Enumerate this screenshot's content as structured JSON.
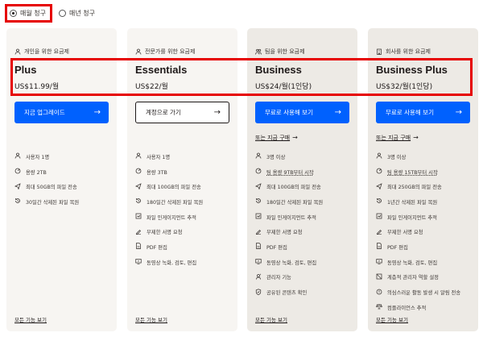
{
  "billing": {
    "monthly_label": "매월 청구",
    "yearly_label": "매년 청구",
    "selected": "monthly"
  },
  "plans": [
    {
      "audience": "개인을 위한 요금제",
      "audience_icon": "person-icon",
      "name": "Plus",
      "price": "US$11.99/월",
      "cta": "지금 업그레이드",
      "cta_style": "blue",
      "buy_link": "",
      "features": [
        {
          "icon": "person-icon",
          "text": "사용자 1명"
        },
        {
          "icon": "storage-icon",
          "text": "용량 2TB"
        },
        {
          "icon": "transfer-icon",
          "text": "최대 50GB의 파일 전송"
        },
        {
          "icon": "restore-icon",
          "text": "30일간 삭제된 파일 복원"
        }
      ],
      "more": "모든 기능 보기"
    },
    {
      "audience": "전문가를 위한 요금제",
      "audience_icon": "person-icon",
      "name": "Essentials",
      "price": "US$22/월",
      "cta": "계정으로 가기",
      "cta_style": "outline",
      "buy_link": "",
      "features": [
        {
          "icon": "person-icon",
          "text": "사용자 1명"
        },
        {
          "icon": "storage-icon",
          "text": "용량 3TB"
        },
        {
          "icon": "transfer-icon",
          "text": "최대 100GB의 파일 전송"
        },
        {
          "icon": "restore-icon",
          "text": "180일간 삭제된 파일 복원"
        },
        {
          "icon": "engagement-icon",
          "text": "파일 인게이지먼트 추적"
        },
        {
          "icon": "signature-icon",
          "text": "무제한 서명 요청"
        },
        {
          "icon": "pdf-icon",
          "text": "PDF 편집"
        },
        {
          "icon": "review-icon",
          "text": "동영상 녹화, 검토, 편집"
        }
      ],
      "more": "모든 기능 보기"
    },
    {
      "audience": "팀을 위한 요금제",
      "audience_icon": "team-icon",
      "name": "Business",
      "price": "US$24/월(1인당)",
      "cta": "무료로 사용해 보기",
      "cta_style": "blue",
      "buy_link": "또는 지금 구매",
      "features": [
        {
          "icon": "person-icon",
          "text": "3명 이상"
        },
        {
          "icon": "storage-icon",
          "text": "팀 용량 9TB부터 시작",
          "underline": true
        },
        {
          "icon": "transfer-icon",
          "text": "최대 100GB의 파일 전송"
        },
        {
          "icon": "restore-icon",
          "text": "180일간 삭제된 파일 복원"
        },
        {
          "icon": "engagement-icon",
          "text": "파일 인게이지먼트 추적"
        },
        {
          "icon": "signature-icon",
          "text": "무제한 서명 요청"
        },
        {
          "icon": "pdf-icon",
          "text": "PDF 편집"
        },
        {
          "icon": "review-icon",
          "text": "동영상 녹화, 검토, 편집"
        },
        {
          "icon": "admin-icon",
          "text": "관리자 기능"
        },
        {
          "icon": "shield-icon",
          "text": "공유된 콘텐츠 확인"
        }
      ],
      "more": "모든 기능 보기"
    },
    {
      "audience": "회사를 위한 요금제",
      "audience_icon": "building-icon",
      "name": "Business Plus",
      "price": "US$32/월(1인당)",
      "cta": "무료로 사용해 보기",
      "cta_style": "blue",
      "buy_link": "또는 지금 구매",
      "features": [
        {
          "icon": "person-icon",
          "text": "3명 이상"
        },
        {
          "icon": "storage-icon",
          "text": "팀 용량 15TB부터 시작",
          "underline": true
        },
        {
          "icon": "transfer-icon",
          "text": "최대 250GB의 파일 전송"
        },
        {
          "icon": "restore-icon",
          "text": "1년간 삭제된 파일 복원"
        },
        {
          "icon": "engagement-icon",
          "text": "파일 인게이지먼트 추적"
        },
        {
          "icon": "signature-icon",
          "text": "무제한 서명 요청"
        },
        {
          "icon": "pdf-icon",
          "text": "PDF 편집"
        },
        {
          "icon": "review-icon",
          "text": "동영상 녹화, 검토, 편집"
        },
        {
          "icon": "roles-icon",
          "text": "계층적 관리자 역할 설정"
        },
        {
          "icon": "alert-icon",
          "text": "의심스러운 활동 발생 시 알림 전송"
        },
        {
          "icon": "compliance-icon",
          "text": "컴플라이언스 추적"
        }
      ],
      "more": "모든 기능 보기"
    }
  ],
  "colors": {
    "accent_blue": "#0061fe",
    "highlight_red": "#e60000",
    "card_light": "#f7f5f2",
    "card_dark": "#edeae5",
    "text": "#1e1919"
  }
}
